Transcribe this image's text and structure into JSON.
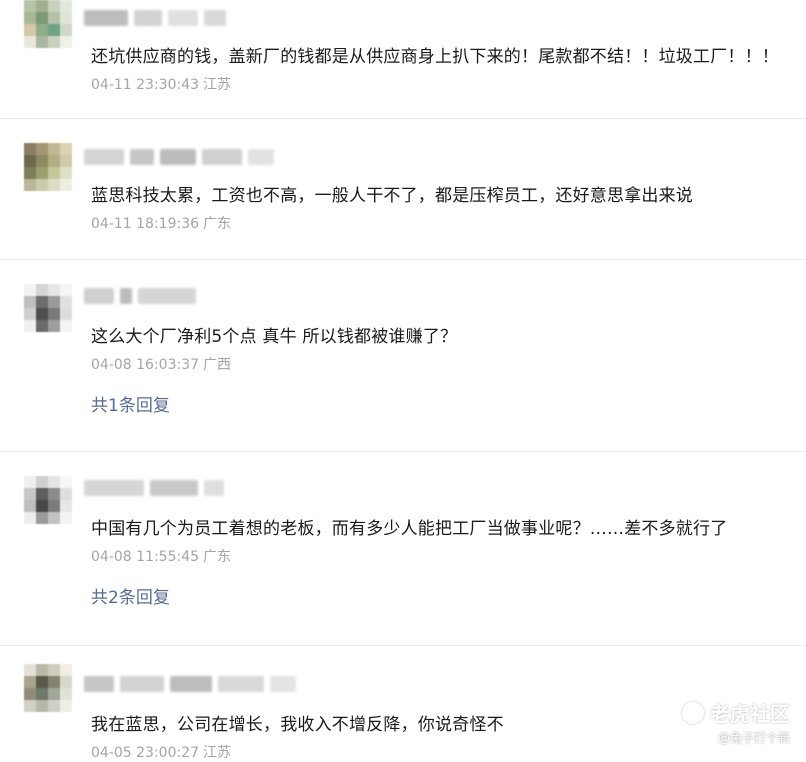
{
  "comments": [
    {
      "text": "还坑供应商的钱，盖新厂的钱都是从供应商身上扒下来的！尾款都不结！！垃圾工厂！！！",
      "time": "04-11 23:30:43",
      "location": "江苏"
    },
    {
      "text": "蓝思科技太累，工资也不高，一般人干不了，都是压榨员工，还好意思拿出来说",
      "time": "04-11 18:19:36",
      "location": "广东"
    },
    {
      "text": "这么大个厂净利5个点 真牛 所以钱都被谁赚了？",
      "time": "04-08 16:03:37",
      "location": "广西",
      "reply": "共1条回复"
    },
    {
      "text": "中国有几个为员工着想的老板，而有多少人能把工厂当做事业呢？……差不多就行了",
      "time": "04-08 11:55:45",
      "location": "广东",
      "reply": "共2条回复"
    },
    {
      "text": "我在蓝思，公司在增长，我收入不增反降，你说奇怪不",
      "time": "04-05 23:00:27",
      "location": "江苏"
    }
  ],
  "watermark": {
    "logo": "老虎社区",
    "user": "@兔子打个新",
    "icon": "tiger-logo-icon"
  },
  "colors": {
    "reply_link": "#576b95",
    "meta": "#a5a5a5",
    "text": "#1a1a1a"
  }
}
